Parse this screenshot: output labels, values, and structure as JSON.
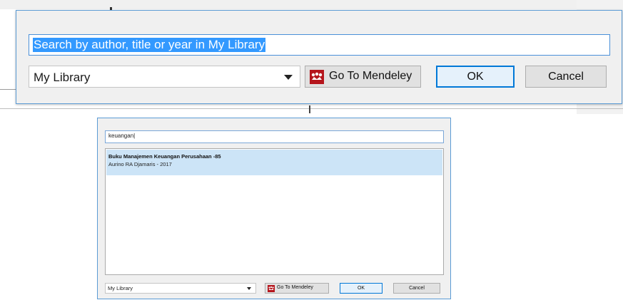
{
  "top_dialog": {
    "search_text": "Search by author, title or year in My Library",
    "library_select": "My Library",
    "mendeley_button": "Go To Mendeley",
    "ok_button": "OK",
    "cancel_button": "Cancel"
  },
  "small_dialog": {
    "search_value": "keuangan|",
    "results": [
      {
        "title": "Buku Manajemen Keuangan Perusahaan -85",
        "subtitle": "Aurino RA Djamaris - 2017"
      }
    ],
    "library_select": "My Library",
    "mendeley_button": "Go To Mendeley",
    "ok_button": "OK",
    "cancel_button": "Cancel"
  },
  "icons": {
    "mendeley_logo": "mendeley-logo-icon",
    "dropdown": "chevron-down-icon"
  },
  "colors": {
    "selection": "#3399ff",
    "item_highlight": "#cce4f7",
    "focus_border": "#0078d7",
    "mendeley_red": "#b5151c"
  }
}
